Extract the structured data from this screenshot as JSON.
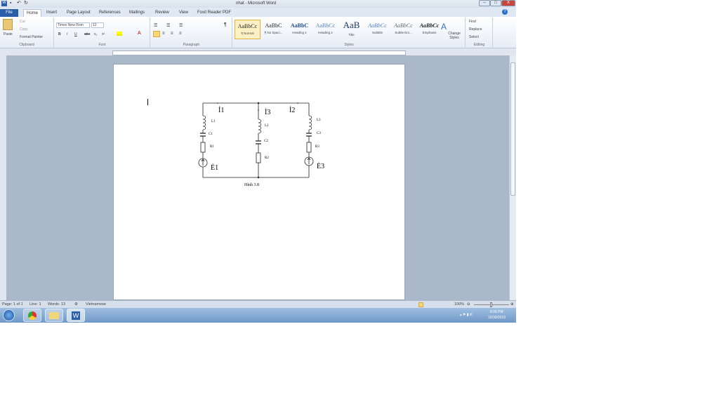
{
  "window": {
    "title": "nhat - Microsoft Word",
    "controls": [
      "–",
      "□",
      "X"
    ]
  },
  "tabs": [
    "File",
    "Home",
    "Insert",
    "Page Layout",
    "References",
    "Mailings",
    "Review",
    "View",
    "Foxit Reader PDF"
  ],
  "clipboard": {
    "paste": "Paste",
    "cut": "Cut",
    "copy": "Copy",
    "format_painter": "Format Painter",
    "label": "Clipboard"
  },
  "font": {
    "name": "Times New Rom",
    "size": "12",
    "label": "Font",
    "buttons": [
      "B",
      "I",
      "U",
      "abe",
      "x₂",
      "x²"
    ]
  },
  "paragraph": {
    "label": "Paragraph",
    "pilcrow": "¶"
  },
  "styles": {
    "label": "Styles",
    "items": [
      {
        "preview": "AaBbCc",
        "name": "¶ Normal"
      },
      {
        "preview": "AaBbC",
        "name": "¶ No Spaci..."
      },
      {
        "preview": "AaBbC",
        "name": "Heading 1"
      },
      {
        "preview": "AaBbCc",
        "name": "Heading 2"
      },
      {
        "preview": "AaB",
        "name": "Title"
      },
      {
        "preview": "AaBbCc",
        "name": "Subtitle"
      },
      {
        "preview": "AaBbCc",
        "name": "Subtle Em..."
      },
      {
        "preview": "AaBbCc",
        "name": "Emphasis"
      }
    ],
    "change": "Change Styles"
  },
  "editing": {
    "label": "Editing",
    "find": "Find",
    "replace": "Replace",
    "select": "Select"
  },
  "circuit": {
    "I1": "İ1",
    "I3": "İ3",
    "I2": "İ2",
    "L1": "L1",
    "C1": "C1",
    "R1": "R1",
    "E1": "Ė1",
    "L2": "L2",
    "C2": "C2",
    "R2": "R2",
    "L3": "L3",
    "C3": "C3",
    "R3": "R3",
    "E3": "Ė3",
    "caption": "Hình 3.8"
  },
  "status": {
    "page": "Page: 1 of 1",
    "line": "Line: 1",
    "words": "Words: 13",
    "language": "Vietnamese",
    "zoom": "100%"
  },
  "clock": {
    "time": "6:00 PM",
    "date": "10/30/2013"
  }
}
